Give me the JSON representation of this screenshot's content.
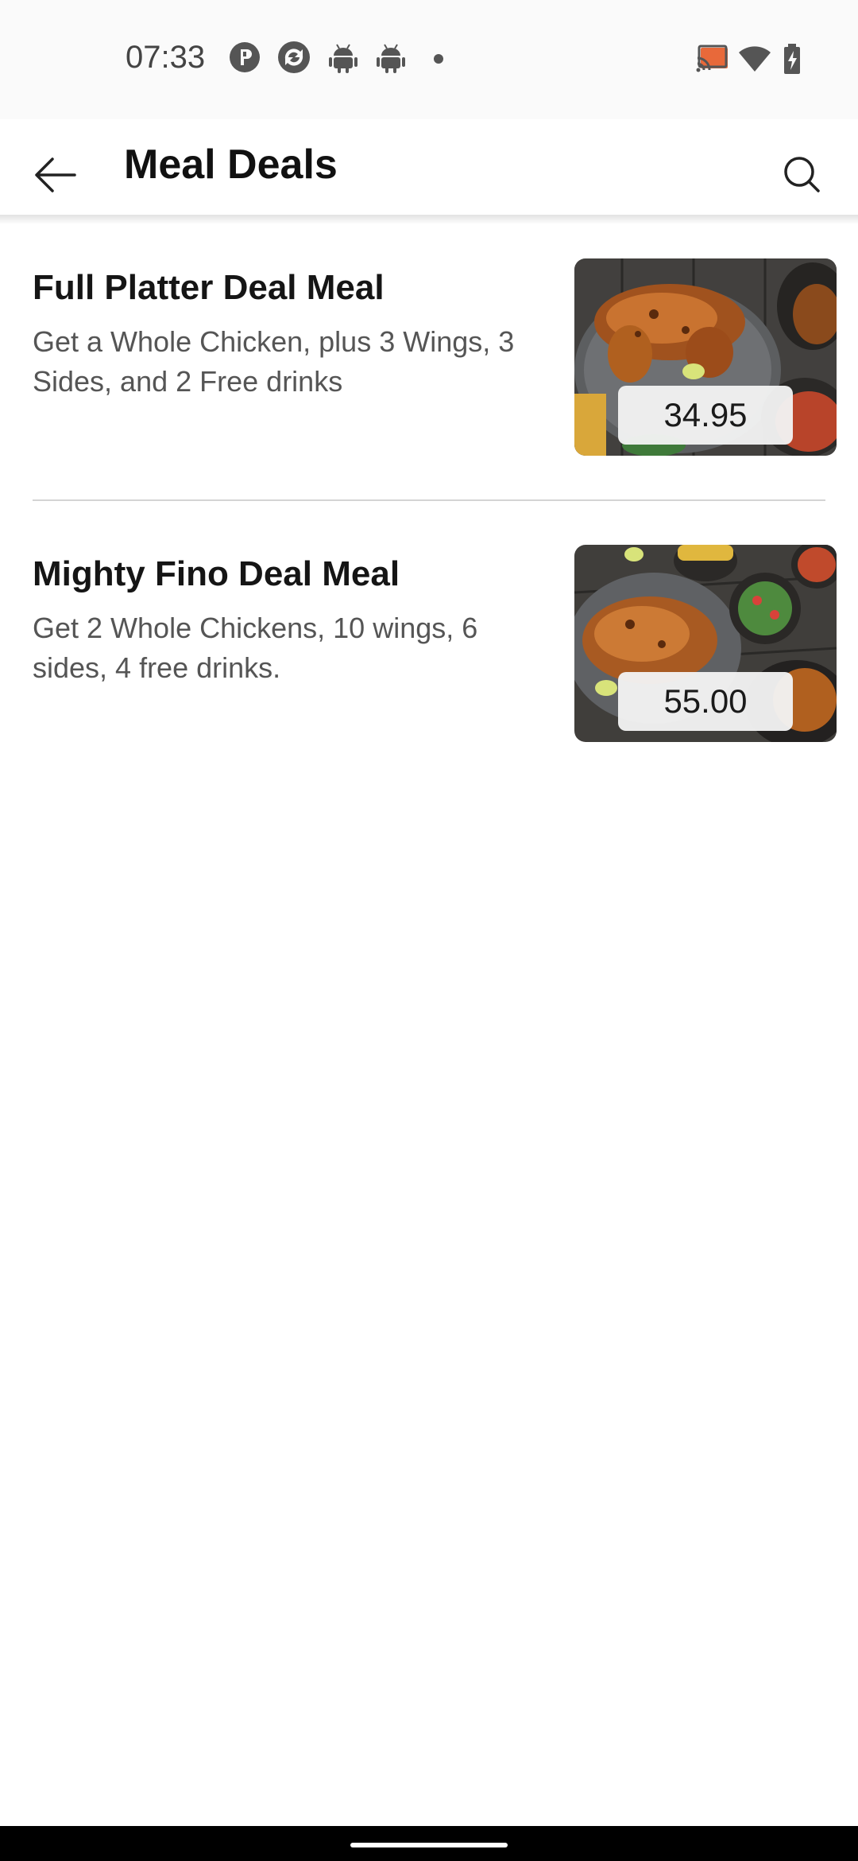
{
  "status_bar": {
    "time": "07:33",
    "left_icons": [
      "pinterest-icon",
      "sync-app-icon",
      "android-icon",
      "android-icon",
      "dot-icon"
    ],
    "right_icons": [
      "cast-icon",
      "wifi-icon",
      "battery-charging-icon"
    ],
    "cast_color": "#e8693a"
  },
  "app_bar": {
    "title": "Meal Deals",
    "back_icon": "arrow-back-icon",
    "search_icon": "search-icon"
  },
  "deals": [
    {
      "title": "Full Platter Deal Meal",
      "description": "Get a Whole Chicken, plus 3 Wings, 3 Sides, and 2 Free drinks",
      "price": "34.95",
      "image": "grilled-chicken-platter-image"
    },
    {
      "title": "Mighty Fino Deal Meal",
      "description": "Get 2 Whole Chickens, 10 wings, 6 sides, 4 free drinks.",
      "price": "55.00",
      "image": "grilled-chicken-feast-image"
    }
  ]
}
